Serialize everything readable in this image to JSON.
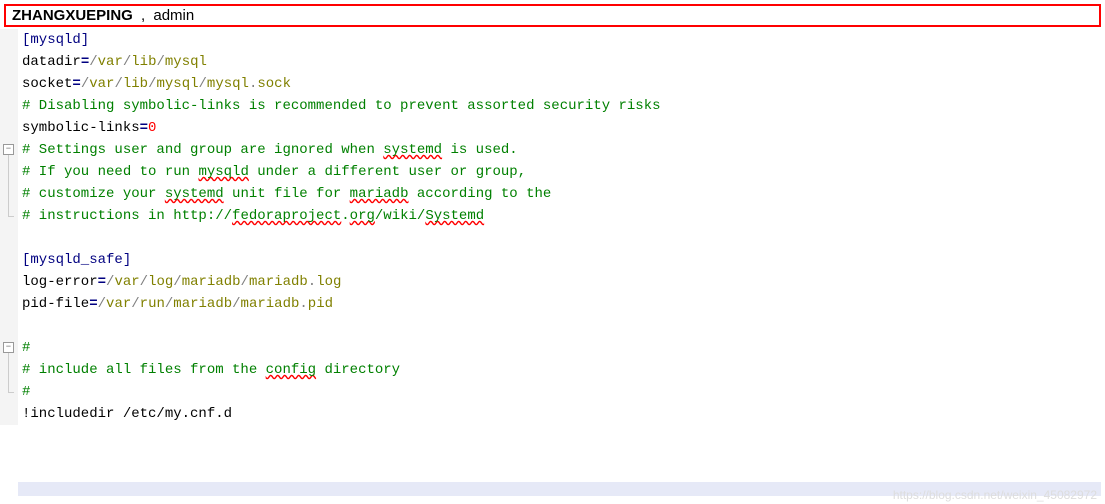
{
  "header": {
    "user": "ZHANGXUEPING",
    "separator": ",",
    "role": "admin"
  },
  "code": {
    "lines": [
      {
        "type": "section",
        "content": "[mysqld]"
      },
      {
        "type": "kv",
        "key": "datadir",
        "value": "/var/lib/mysql"
      },
      {
        "type": "kv",
        "key": "socket",
        "value": "/var/lib/mysql/mysql.sock"
      },
      {
        "type": "comment",
        "content": "# Disabling symbolic-links is recommended to prevent assorted security risks"
      },
      {
        "type": "kvnum",
        "key": "symbolic-links",
        "value": "0"
      },
      {
        "type": "comment",
        "content": "# Settings user and group are ignored when systemd is used.",
        "spell": [
          "systemd"
        ]
      },
      {
        "type": "comment",
        "content": "# If you need to run mysqld under a different user or group,",
        "spell": [
          "mysqld"
        ]
      },
      {
        "type": "comment",
        "content": "# customize your systemd unit file for mariadb according to the",
        "spell": [
          "systemd",
          "mariadb"
        ]
      },
      {
        "type": "comment",
        "content": "# instructions in http://fedoraproject.org/wiki/Systemd",
        "spell": [
          "fedoraproject",
          "org",
          "Systemd"
        ]
      },
      {
        "type": "blank"
      },
      {
        "type": "section",
        "content": "[mysqld_safe]"
      },
      {
        "type": "kv",
        "key": "log-error",
        "value": "/var/log/mariadb/mariadb.log"
      },
      {
        "type": "kv",
        "key": "pid-file",
        "value": "/var/run/mariadb/mariadb.pid"
      },
      {
        "type": "blank"
      },
      {
        "type": "comment",
        "content": "#"
      },
      {
        "type": "comment",
        "content": "# include all files from the config directory",
        "spell": [
          "config"
        ]
      },
      {
        "type": "comment",
        "content": "#"
      },
      {
        "type": "plain",
        "content": "!includedir /etc/my.cnf.d"
      }
    ]
  },
  "folds": [
    {
      "start": 5,
      "end": 8,
      "symbol": "⊟"
    },
    {
      "start": 14,
      "end": 16,
      "symbol": "⊟"
    }
  ],
  "watermark": "https://blog.csdn.net/weixin_45082972"
}
